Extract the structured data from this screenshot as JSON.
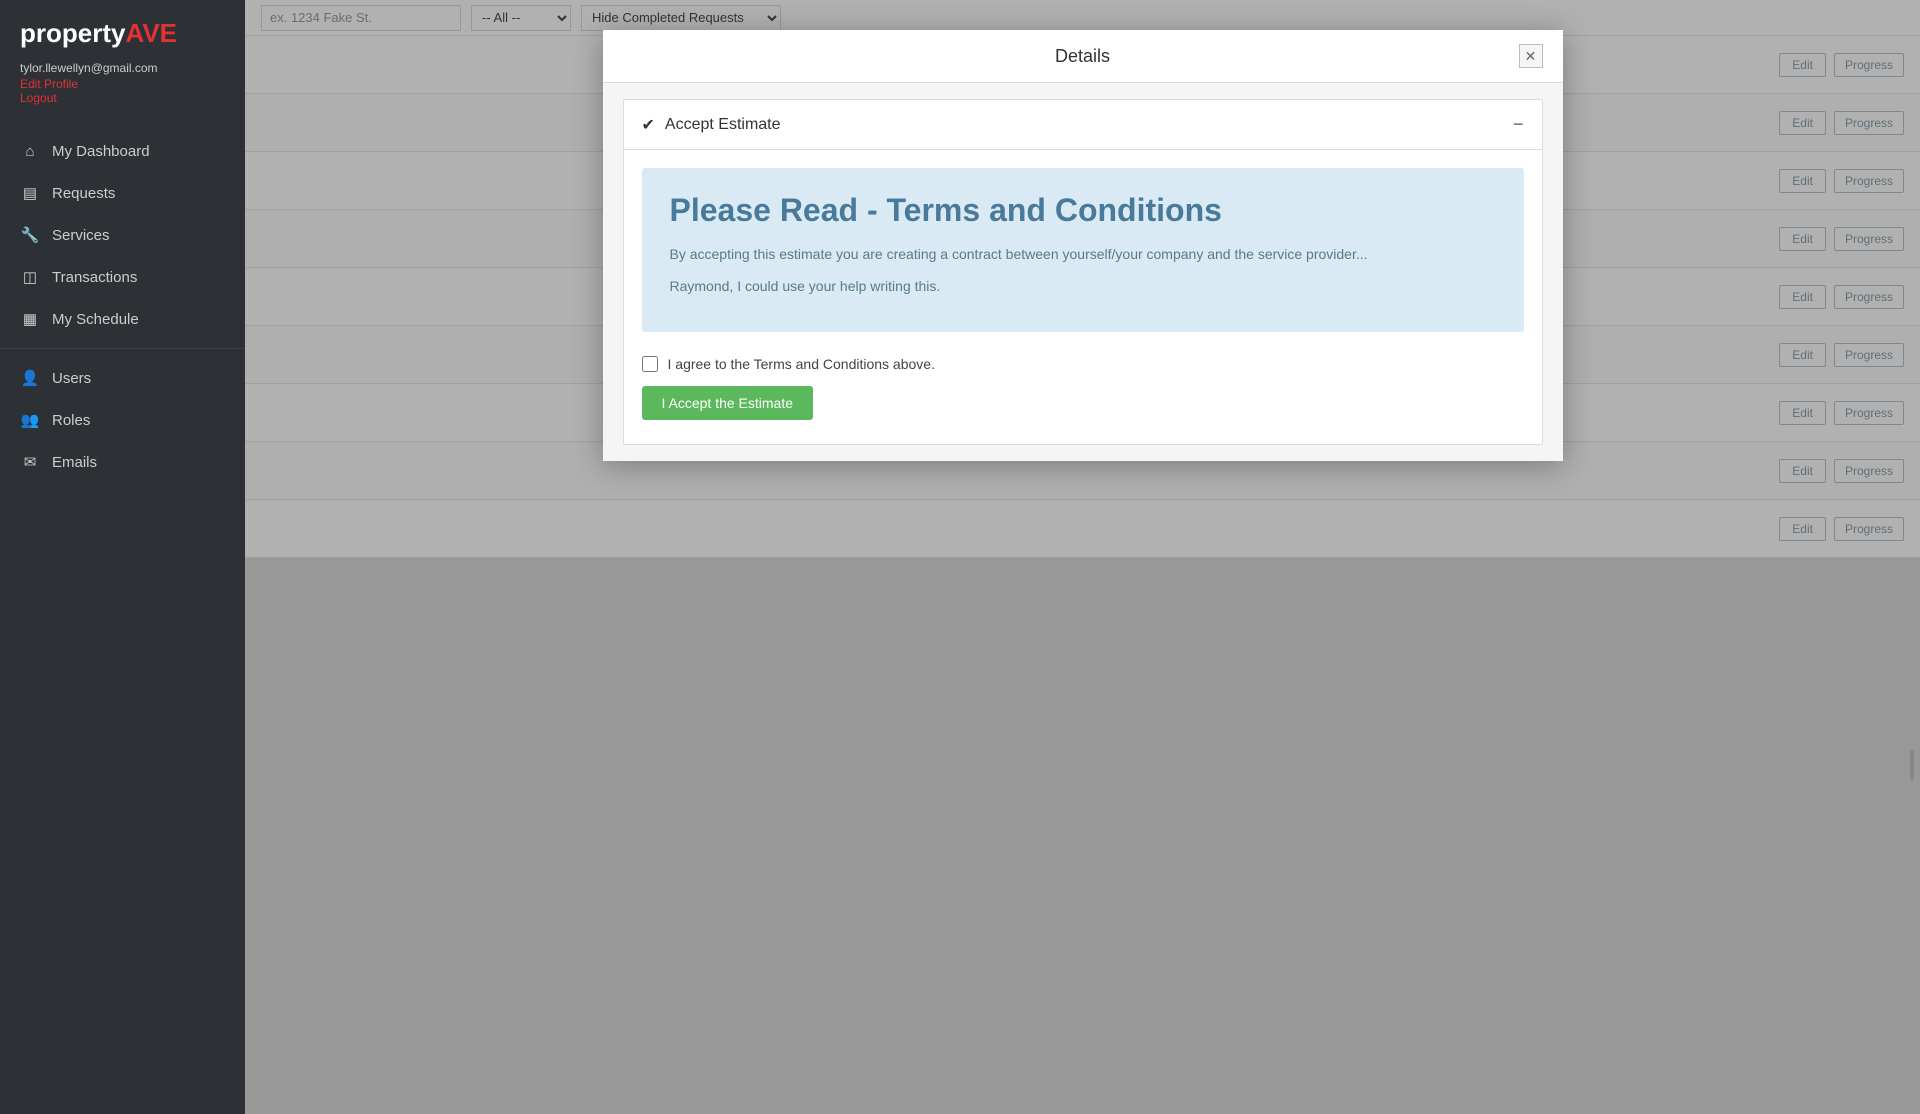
{
  "sidebar": {
    "logo": {
      "property": "property",
      "ave": "AVE"
    },
    "user": {
      "email": "tylor.llewellyn@gmail.com",
      "edit_label": "Edit Profile",
      "logout_label": "Logout"
    },
    "nav_items": [
      {
        "id": "dashboard",
        "label": "My Dashboard",
        "icon": "⌂"
      },
      {
        "id": "requests",
        "label": "Requests",
        "icon": "▤"
      },
      {
        "id": "services",
        "label": "Services",
        "icon": "🔧"
      },
      {
        "id": "transactions",
        "label": "Transactions",
        "icon": "◫"
      },
      {
        "id": "schedule",
        "label": "My Schedule",
        "icon": "▦"
      }
    ],
    "admin_items": [
      {
        "id": "users",
        "label": "Users",
        "icon": "👤"
      },
      {
        "id": "roles",
        "label": "Roles",
        "icon": "👥"
      },
      {
        "id": "emails",
        "label": "Emails",
        "icon": "✉"
      }
    ]
  },
  "top_bar": {
    "address_placeholder": "ex. 1234 Fake St.",
    "filter_all": "-- All --",
    "filter_status": "Hide Completed Requests"
  },
  "table": {
    "rows": [
      {
        "edit": "Edit",
        "progress": "Progress"
      },
      {
        "edit": "Edit",
        "progress": "Progress"
      },
      {
        "edit": "Edit",
        "progress": "Progress"
      },
      {
        "edit": "Edit",
        "progress": "Progress"
      },
      {
        "edit": "Edit",
        "progress": "Progress"
      },
      {
        "edit": "Edit",
        "progress": "Progress"
      },
      {
        "edit": "Edit",
        "progress": "Progress"
      },
      {
        "edit": "Edit",
        "progress": "Progress"
      },
      {
        "edit": "Edit",
        "progress": "Progress"
      }
    ]
  },
  "modal": {
    "title": "Details",
    "close_label": "✕",
    "accordion": {
      "check_icon": "✔",
      "title": "Accept Estimate",
      "collapse_icon": "−"
    },
    "terms": {
      "title": "Please Read - Terms and Conditions",
      "text1": "By accepting this estimate you are creating a contract between yourself/your company and the service provider...",
      "text2": "Raymond, I could use your help writing this."
    },
    "agree": {
      "label": "I agree to the Terms and Conditions above."
    },
    "accept_button": "I Accept the Estimate"
  }
}
